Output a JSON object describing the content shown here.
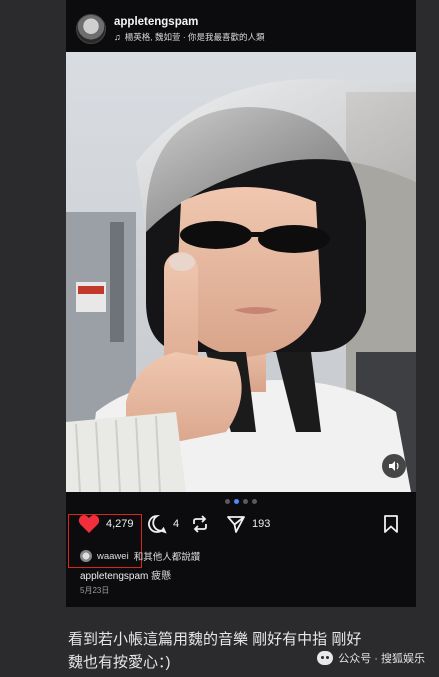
{
  "post": {
    "username": "appletengspam",
    "music": "楊英格, 魏如萱 · 你是我最喜歡的人類",
    "carousel": {
      "count": 4,
      "active_index": 1
    },
    "actions": {
      "likes": "4,279",
      "comments": "4",
      "shares": "193"
    },
    "liked_by": {
      "user": "waawei",
      "suffix": "和其他人都說讚"
    },
    "caption": {
      "user": "appletengspam",
      "text": "疲懸"
    },
    "date": "5月23日"
  },
  "comment_text_line1": "看到若小帳這篇用魏的音樂 剛好有中指 剛好",
  "comment_text_line2": "魏也有按愛心：)",
  "watermark": {
    "text": "公众号 · 搜狐娱乐"
  },
  "colors": {
    "like_red": "#ef2f3c",
    "highlight": "#d9261c",
    "accent_blue": "#4d8bf5"
  }
}
